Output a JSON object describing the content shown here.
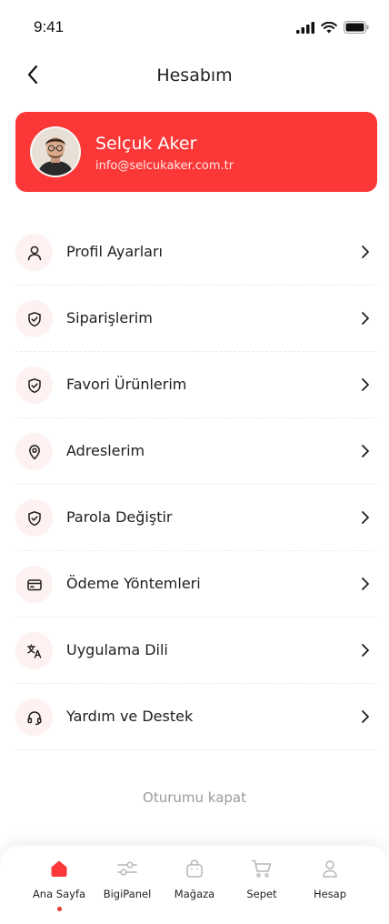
{
  "status_bar": {
    "time": "9:41"
  },
  "header": {
    "title": "Hesabım"
  },
  "profile": {
    "name": "Selçuk Aker",
    "email": "info@selcukaker.com.tr"
  },
  "menu": [
    {
      "label": "Profil Ayarları",
      "icon": "user-icon"
    },
    {
      "label": "Siparişlerim",
      "icon": "shield-check-icon"
    },
    {
      "label": "Favori Ürünlerim",
      "icon": "shield-check-icon"
    },
    {
      "label": "Adreslerim",
      "icon": "location-pin-icon"
    },
    {
      "label": "Parola Değiştir",
      "icon": "shield-check-icon"
    },
    {
      "label": "Ödeme Yöntemleri",
      "icon": "credit-card-icon"
    },
    {
      "label": "Uygulama Dili",
      "icon": "translate-icon"
    },
    {
      "label": "Yardım ve Destek",
      "icon": "headset-icon"
    }
  ],
  "logout_label": "Oturumu kapat",
  "tabs": [
    {
      "label": "Ana Sayfa",
      "icon": "home-icon",
      "active": true
    },
    {
      "label": "BigiPanel",
      "icon": "sliders-icon",
      "active": false
    },
    {
      "label": "Mağaza",
      "icon": "shopping-bag-icon",
      "active": false
    },
    {
      "label": "Sepet",
      "icon": "cart-icon",
      "active": false
    },
    {
      "label": "Hesap",
      "icon": "user-icon",
      "active": false
    }
  ],
  "colors": {
    "accent": "#fb3737",
    "icon_bg": "#fdf1f1",
    "muted": "#9b9b9b",
    "tab_inactive": "#b5b5b5"
  }
}
